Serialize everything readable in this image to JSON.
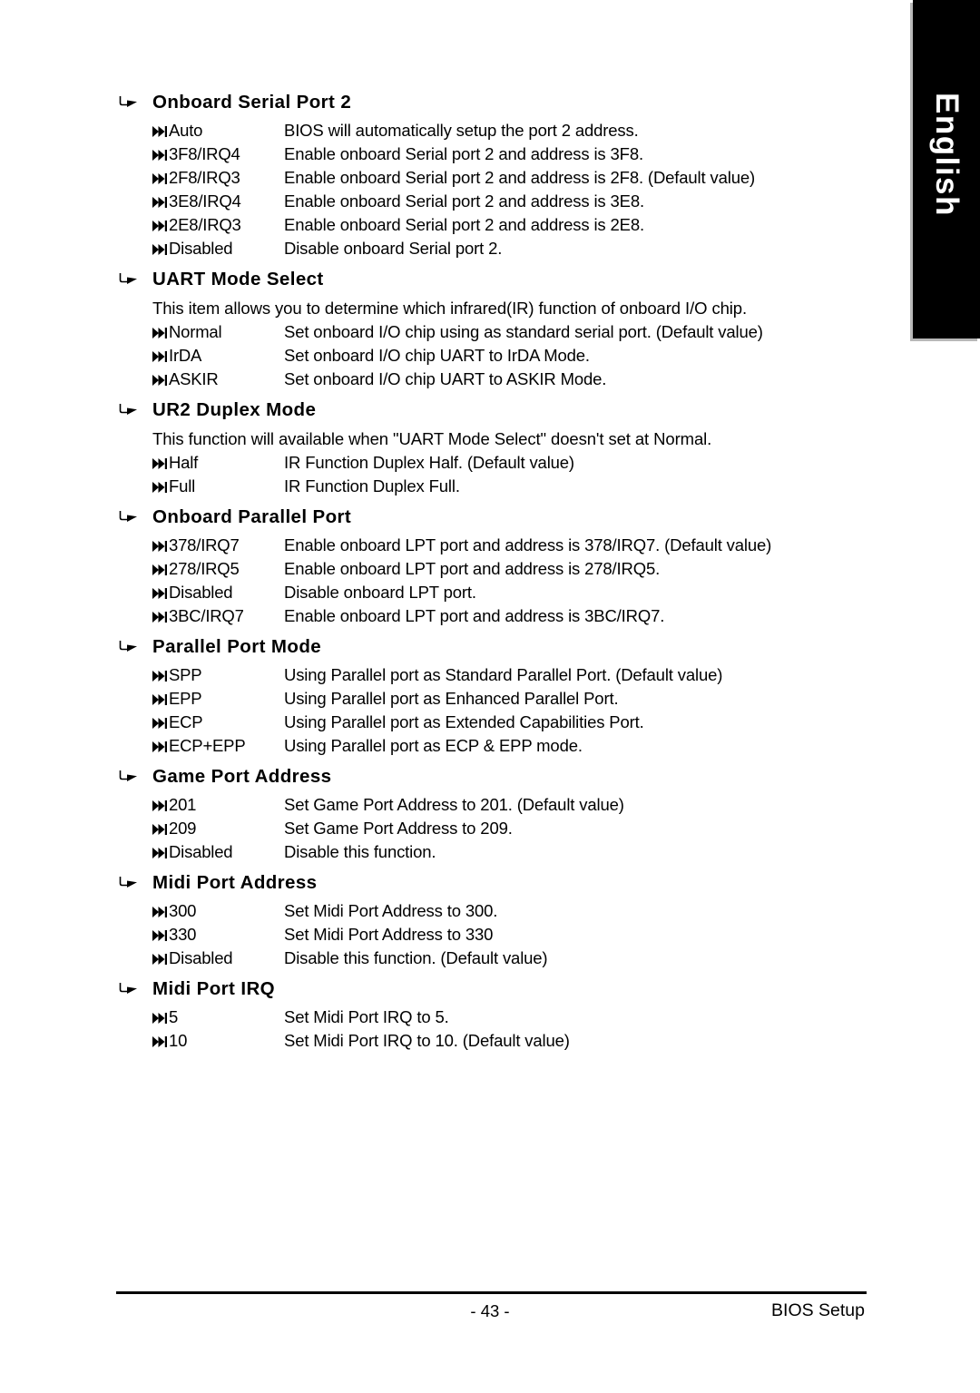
{
  "language_tab": {
    "label": "English"
  },
  "footer": {
    "page_number": "- 43 -",
    "document_label": "BIOS Setup"
  },
  "glyphs": {
    "section_bullet": "curved-arrow-bullet-icon",
    "option_bullet": "double-triangle-bullet-icon"
  },
  "sections": [
    {
      "title": "Onboard Serial Port 2",
      "paragraph": "",
      "options": [
        {
          "label": "Auto",
          "desc": "BIOS will automatically setup the port 2 address."
        },
        {
          "label": "3F8/IRQ4",
          "desc": "Enable onboard Serial port 2 and address is 3F8."
        },
        {
          "label": "2F8/IRQ3",
          "desc": "Enable onboard Serial port 2 and address is 2F8. (Default value)"
        },
        {
          "label": "3E8/IRQ4",
          "desc": "Enable onboard Serial port 2 and address is 3E8."
        },
        {
          "label": "2E8/IRQ3",
          "desc": "Enable onboard Serial port 2 and address is 2E8."
        },
        {
          "label": "Disabled",
          "desc": "Disable onboard Serial port 2."
        }
      ]
    },
    {
      "title": "UART Mode Select",
      "paragraph": "This item allows you to determine which infrared(IR) function of onboard I/O chip.",
      "options": [
        {
          "label": "Normal",
          "desc": "Set onboard I/O chip using as standard serial port. (Default value)"
        },
        {
          "label": "IrDA",
          "desc": "Set onboard I/O chip UART to IrDA Mode."
        },
        {
          "label": "ASKIR",
          "desc": "Set onboard I/O chip UART to ASKIR Mode."
        }
      ]
    },
    {
      "title": "UR2 Duplex Mode",
      "paragraph": "This function will available when \"UART Mode Select\" doesn't set at Normal.",
      "options": [
        {
          "label": "Half",
          "desc": "IR Function Duplex Half. (Default value)"
        },
        {
          "label": "Full",
          "desc": "IR Function Duplex Full."
        }
      ]
    },
    {
      "title": "Onboard Parallel Port",
      "paragraph": "",
      "options": [
        {
          "label": "378/IRQ7",
          "desc": "Enable onboard LPT port and address is 378/IRQ7. (Default value)"
        },
        {
          "label": "278/IRQ5",
          "desc": "Enable onboard LPT port and address is 278/IRQ5."
        },
        {
          "label": "Disabled",
          "desc": "Disable onboard LPT port."
        },
        {
          "label": "3BC/IRQ7",
          "desc": "Enable onboard LPT port and address is 3BC/IRQ7."
        }
      ]
    },
    {
      "title": "Parallel Port Mode",
      "paragraph": "",
      "options": [
        {
          "label": "SPP",
          "desc": "Using Parallel port as Standard Parallel Port. (Default value)"
        },
        {
          "label": "EPP",
          "desc": "Using Parallel port as Enhanced Parallel Port."
        },
        {
          "label": "ECP",
          "desc": "Using Parallel port as Extended Capabilities Port."
        },
        {
          "label": "ECP+EPP",
          "desc": "Using Parallel port as ECP & EPP mode."
        }
      ]
    },
    {
      "title": "Game Port Address",
      "paragraph": "",
      "options": [
        {
          "label": "201",
          "desc": "Set Game Port Address to 201. (Default value)"
        },
        {
          "label": "209",
          "desc": "Set Game Port Address to 209."
        },
        {
          "label": "Disabled",
          "desc": "Disable this function."
        }
      ]
    },
    {
      "title": "Midi Port Address",
      "paragraph": "",
      "options": [
        {
          "label": "300",
          "desc": "Set Midi Port Address to 300."
        },
        {
          "label": "330",
          "desc": "Set Midi Port Address to 330"
        },
        {
          "label": "Disabled",
          "desc": "Disable this function. (Default value)"
        }
      ]
    },
    {
      "title": "Midi Port IRQ",
      "paragraph": "",
      "options": [
        {
          "label": "5",
          "desc": "Set Midi Port IRQ to 5."
        },
        {
          "label": "10",
          "desc": "Set Midi Port IRQ to 10. (Default value)"
        }
      ]
    }
  ]
}
